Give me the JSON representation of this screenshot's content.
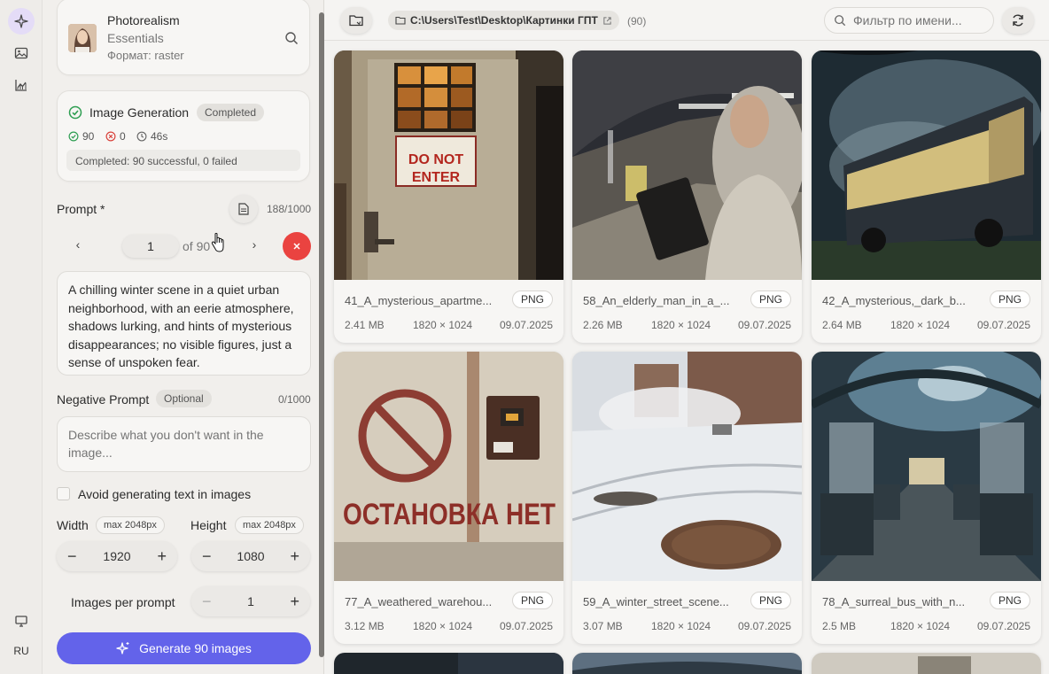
{
  "rail": {
    "lang": "RU"
  },
  "model": {
    "name": "Photorealism",
    "subtitle": "Essentials",
    "format": "Формат: raster"
  },
  "job": {
    "title": "Image Generation",
    "status": "Completed",
    "ok": "90",
    "fail": "0",
    "time": "46s",
    "summary": "Completed: 90 successful, 0 failed"
  },
  "prompt": {
    "label": "Prompt *",
    "count": "188/1000",
    "page": "1",
    "of": "of 90",
    "text": "A chilling winter scene in a quiet urban neighborhood, with an eerie atmosphere, shadows lurking, and hints of mysterious disappearances; no visible figures, just a sense of unspoken fear."
  },
  "negative": {
    "label": "Negative Prompt",
    "badge": "Optional",
    "count": "0/1000",
    "placeholder": "Describe what you don't want in the image..."
  },
  "avoid_text": "Avoid generating text in images",
  "width": {
    "label": "Width",
    "max": "max 2048px",
    "value": "1920"
  },
  "height": {
    "label": "Height",
    "max": "max 2048px",
    "value": "1080"
  },
  "per_prompt": {
    "label": "Images per prompt",
    "value": "1"
  },
  "generate_label": "Generate 90 images",
  "topbar": {
    "path": "C:\\Users\\Test\\Desktop\\Картинки ГПТ",
    "count": "(90)",
    "filter_placeholder": "Фильтр по имени..."
  },
  "images": [
    {
      "name": "41_A_mysterious_apartme...",
      "format": "PNG",
      "size": "2.41 MB",
      "dims": "1820 × 1024",
      "date": "09.07.2025",
      "sign": "DO NOT ENTER"
    },
    {
      "name": "58_An_elderly_man_in_a_...",
      "format": "PNG",
      "size": "2.26 MB",
      "dims": "1820 × 1024",
      "date": "09.07.2025"
    },
    {
      "name": "42_A_mysterious,_dark_b...",
      "format": "PNG",
      "size": "2.64 MB",
      "dims": "1820 × 1024",
      "date": "09.07.2025"
    },
    {
      "name": "77_A_weathered_warehou...",
      "format": "PNG",
      "size": "3.12 MB",
      "dims": "1820 × 1024",
      "date": "09.07.2025",
      "sign": "ОСТАНОВКА НЕТ"
    },
    {
      "name": "59_A_winter_street_scene...",
      "format": "PNG",
      "size": "3.07 MB",
      "dims": "1820 × 1024",
      "date": "09.07.2025"
    },
    {
      "name": "78_A_surreal_bus_with_n...",
      "format": "PNG",
      "size": "2.5 MB",
      "dims": "1820 × 1024",
      "date": "09.07.2025"
    }
  ]
}
